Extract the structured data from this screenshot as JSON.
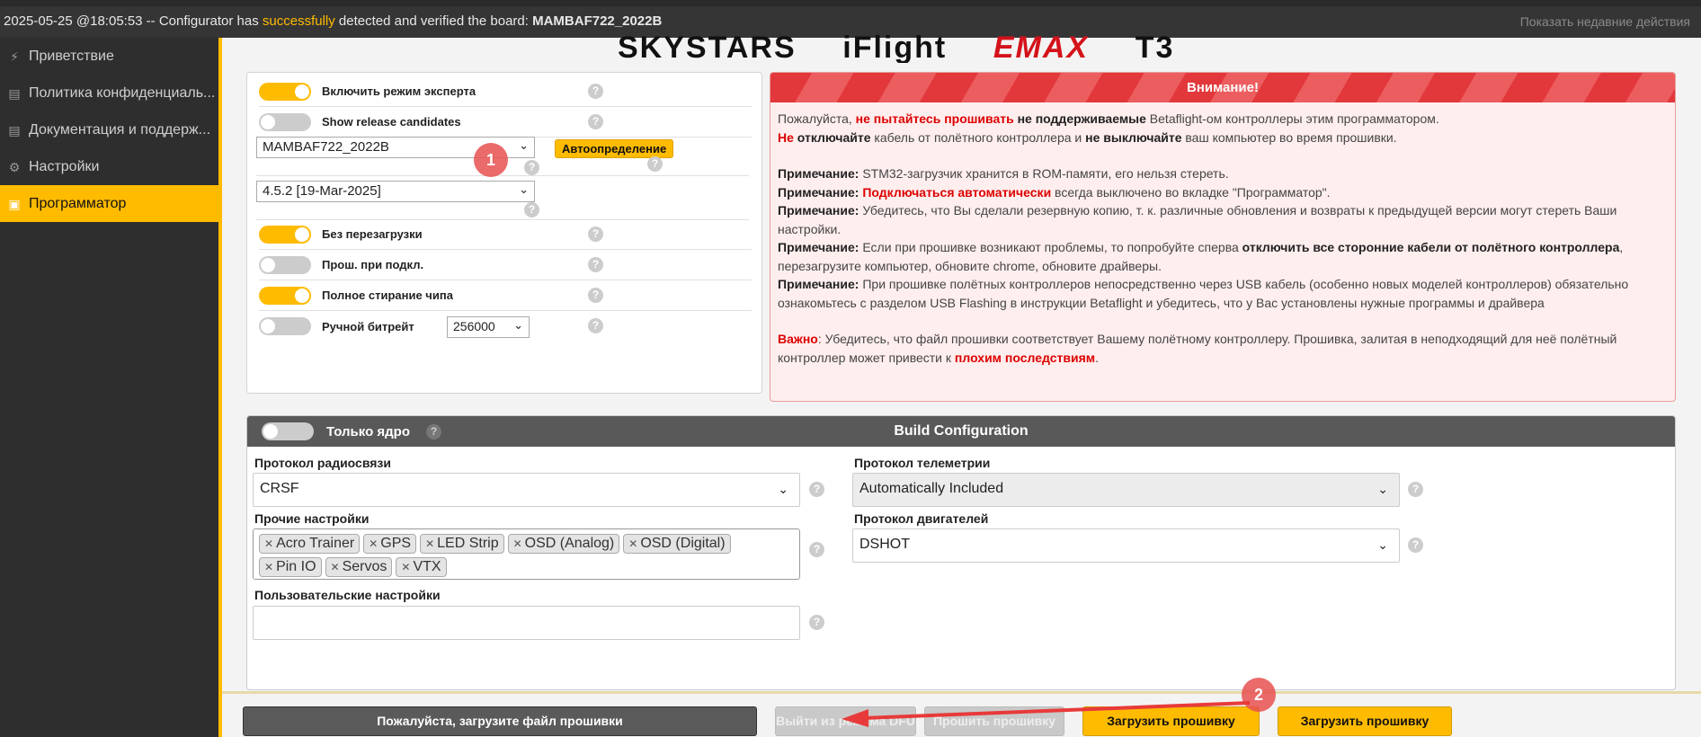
{
  "statusbar": {
    "log_prefix": "2025-05-25 @18:05:53 -- Configurator has ",
    "log_ok": "successfully",
    "log_middle": " detected and verified the board: ",
    "log_board": "MAMBAF722_2022B",
    "recent_label": "Показать недавние действия"
  },
  "sidebar": {
    "items": [
      {
        "label": "Приветствие",
        "icon": "plug-icon"
      },
      {
        "label": "Политика конфиденциаль...",
        "icon": "document-icon"
      },
      {
        "label": "Документация и поддерж...",
        "icon": "book-icon"
      },
      {
        "label": "Настройки",
        "icon": "gear-icon"
      },
      {
        "label": "Программатор",
        "icon": "chip-icon"
      }
    ]
  },
  "logos": [
    "SKYSTARS",
    "iFlight",
    "EMAX",
    "T3"
  ],
  "options": {
    "expert_mode": "Включить режим эксперта",
    "release_candidates": "Show release candidates",
    "board_value": "MAMBAF722_2022B",
    "autodetect": "Автоопределение",
    "firmware_value": "4.5.2 [19-Mar-2025]",
    "no_reboot": "Без перезагрузки",
    "flash_on_connect": "Прош. при подкл.",
    "full_erase": "Полное стирание чипа",
    "manual_baud": "Ручной битрейт",
    "baud_value": "256000",
    "help_glyph": "?"
  },
  "warning": {
    "title": "Внимание!",
    "l1_a": "Пожалуйста, ",
    "l1_r": "не пытайтесь прошивать",
    "l1_b": " не поддерживаемые",
    "l1_c": " Betaflight-ом контроллеры этим программатором.",
    "l2_r": "Не",
    "l2_b1": " отключайте",
    "l2_c1": " кабель от полётного контроллера и ",
    "l2_b2": "не выключайте",
    "l2_c2": " ваш компьютер во время прошивки.",
    "note": "Примечание:",
    "n1": " STM32-загрузчик хранится в ROM-памяти, его нельзя стереть.",
    "n2_r": " Подключаться автоматически",
    "n2": " всегда выключено во вкладке \"Программатор\".",
    "n3": " Убедитесь, что Вы сделали резервную копию, т. к. различные обновления и возвраты к предыдущей версии могут стереть Ваши настройки.",
    "n4_a": " Если при прошивке возникают проблемы, то попробуйте сперва ",
    "n4_b": "отключить все сторонние кабели от полётного контроллера",
    "n4_c": ", перезагрузите компьютер, обновите chrome, обновите драйверы.",
    "n5": " При прошивке полётных контроллеров непосредственно через USB кабель (особенно новых моделей контроллеров) обязательно ознакомьтесь с разделом USB Flashing в инструкции Betaflight и убедитесь, что у Вас установлены нужные программы и драйвера",
    "imp": "Важно",
    "imp_a": ": Убедитесь, что файл прошивки соответствует Вашему полётному контроллеру. Прошивка, залитая в неподходящий для неё полётный контроллер может привести к ",
    "imp_r": "плохим последствиям",
    "imp_end": "."
  },
  "build": {
    "title": "Build Configuration",
    "core_only": "Только ядро",
    "radio_label": "Протокол радиосвязи",
    "radio_value": "CRSF",
    "telemetry_label": "Протокол телеметрии",
    "telemetry_value": "Automatically Included",
    "other_label": "Прочие настройки",
    "other_tags": [
      "Acro Trainer",
      "GPS",
      "LED Strip",
      "OSD (Analog)",
      "OSD (Digital)",
      "Pin IO",
      "Servos",
      "VTX"
    ],
    "motor_label": "Протокол двигателей",
    "motor_value": "DSHOT",
    "custom_label": "Пользовательские настройки",
    "custom_value": ""
  },
  "bottom": {
    "load_file": "Пожалуйста, загрузите файл прошивки",
    "exit_dfu": "Выйти из режима DFU",
    "flash": "Прошить прошивку",
    "load_online": "Загрузить прошивку [Online]",
    "load_local": "Загрузить прошивку [Local]"
  },
  "annotations": {
    "badge1": "1",
    "badge2": "2"
  }
}
